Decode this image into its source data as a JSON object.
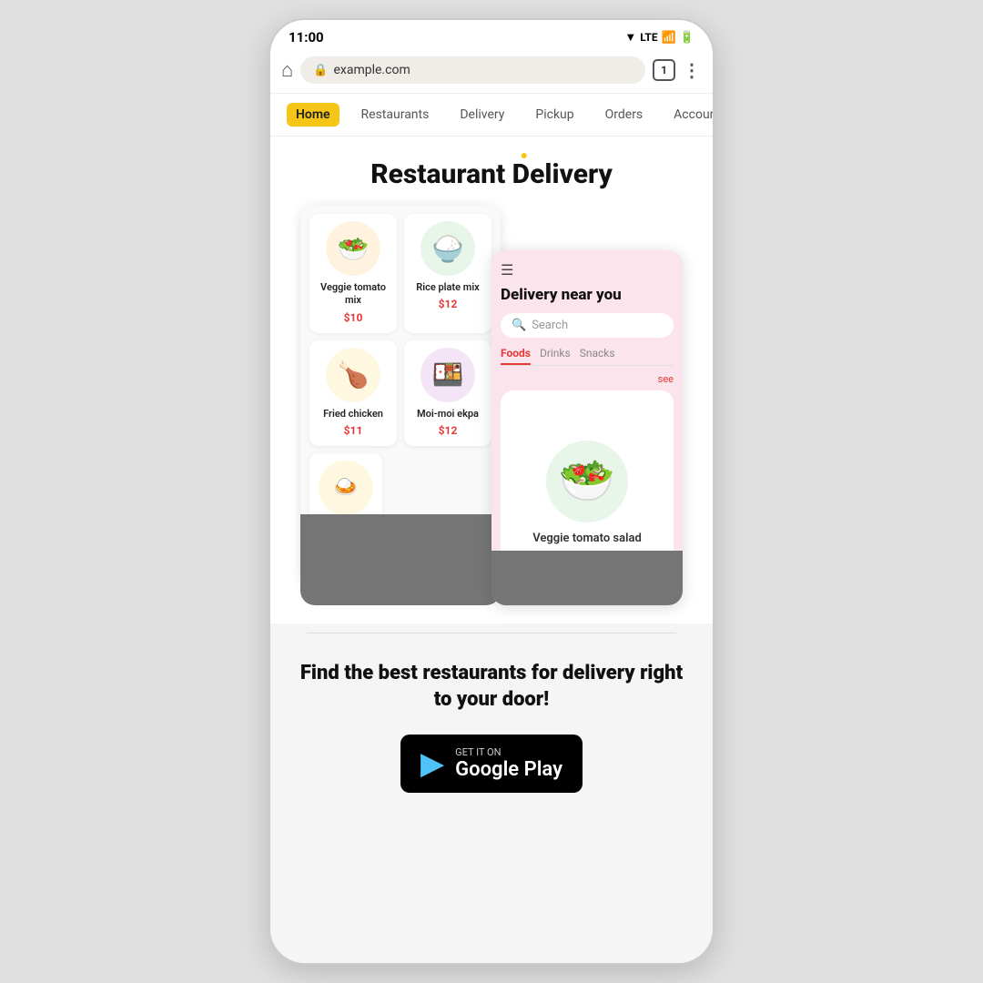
{
  "phone": {
    "status_bar": {
      "time": "11:00",
      "signal": "LTE",
      "wifi_icon": "wifi",
      "battery_icon": "battery"
    },
    "browser": {
      "url": "example.com",
      "tab_count": "1"
    },
    "nav": {
      "items": [
        {
          "label": "Home",
          "active": true
        },
        {
          "label": "Restaurants",
          "active": false
        },
        {
          "label": "Delivery",
          "active": false
        },
        {
          "label": "Pickup",
          "active": false
        },
        {
          "label": "Orders",
          "active": false
        },
        {
          "label": "Account",
          "active": false
        }
      ]
    },
    "hero": {
      "title_part1": "Restaurant ",
      "title_part2": "D",
      "title_dot": "·",
      "title_part3": "elivery"
    },
    "left_screenshot": {
      "foods": [
        {
          "name": "Veggie tomato mix",
          "price": "$10",
          "emoji": "🥗",
          "bg": "food-img-veggie-tomato"
        },
        {
          "name": "Rice plate mix",
          "price": "$12",
          "emoji": "🍚",
          "bg": "food-img-rice"
        },
        {
          "name": "Fried chicken",
          "price": "$11",
          "emoji": "🍗",
          "bg": "food-img-fried"
        },
        {
          "name": "Moi-moi ekpa",
          "price": "$12",
          "emoji": "🍱",
          "bg": "food-img-moi"
        }
      ]
    },
    "right_screenshot": {
      "menu_icon": "☰",
      "title": "Delivery near you",
      "search_placeholder": "Search",
      "tabs": [
        {
          "label": "Foods",
          "active": true
        },
        {
          "label": "Drinks",
          "active": false
        },
        {
          "label": "Snacks",
          "active": false
        }
      ],
      "see_all": "see",
      "featured_food": {
        "name": "Veggie tomato salad",
        "emoji": "🥗",
        "bg": "food-img-salad"
      }
    },
    "cta": {
      "text": "Find the best restaurants for delivery right to your door!",
      "google_play": {
        "label_small": "GET IT ON",
        "label_big": "Google Play",
        "play_icon": "▶"
      }
    }
  }
}
